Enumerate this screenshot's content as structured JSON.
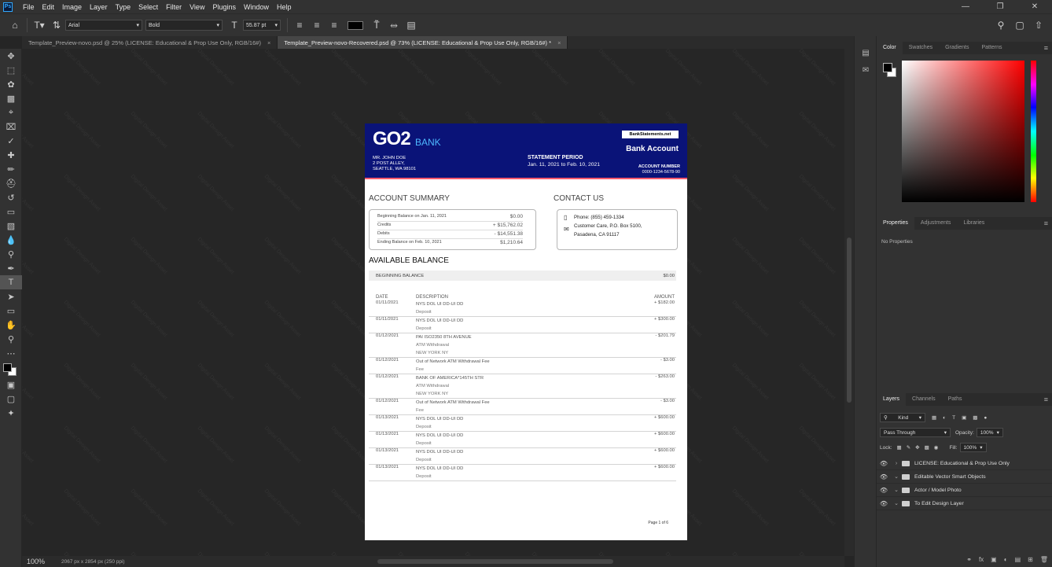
{
  "menubar": {
    "items": [
      "File",
      "Edit",
      "Image",
      "Layer",
      "Type",
      "Select",
      "Filter",
      "View",
      "Plugins",
      "Window",
      "Help"
    ],
    "logo": "Ps"
  },
  "options": {
    "font_family": "Arial",
    "font_style": "Bold",
    "font_size": "55.87 pt"
  },
  "tabs": [
    {
      "label": "Template_Preview-novo.psd @ 25% (LICENSE: Educational & Prop Use Only, RGB/16#)",
      "active": false
    },
    {
      "label": "Template_Preview-novo-Recovered.psd @ 73% (LICENSE: Educational & Prop Use Only, RGB/16#) *",
      "active": true
    }
  ],
  "status": {
    "zoom": "100%",
    "info": "2067 px x 2854 px (250 ppi)"
  },
  "watermark": "Digital Design Asset",
  "doc": {
    "logo_text": "GO2",
    "logo_bank": "BANK",
    "name": "MR. JOHN DOE",
    "addr1": "2 POST ALLEY,",
    "addr2": "SEATTLE, WA 98101",
    "period_label": "STATEMENT PERIOD",
    "period": "Jan. 11, 2021 to Feb. 10, 2021",
    "badge": "BankStatements.net",
    "title": "Bank Account",
    "acct_label": "ACCOUNT NUMBER",
    "acct": "0000-1234-5678-90",
    "summary_title": "ACCOUNT SUMMARY",
    "contact_title": "CONTACT US",
    "summary": [
      {
        "label": "Beginning Balance on Jan. 11, 2021",
        "value": "$0.00"
      },
      {
        "label": "Credits",
        "value": "+ $15,762.02"
      },
      {
        "label": "Debits",
        "value": "- $14,551.38"
      },
      {
        "label": "Ending Balance on Feb. 10, 2021",
        "value": "$1,210.64"
      }
    ],
    "contact": {
      "phone": "Phone: (855) 459-1334",
      "line1": "Customer Care, P.O. Box 5100,",
      "line2": "Pasadena, CA 91117"
    },
    "avail_title": "AVAILABLE BALANCE",
    "beg_label": "BEGINNING BALANCE",
    "beg_value": "$0.00",
    "th": {
      "date": "DATE",
      "desc": "DESCRIPTION",
      "amount": "AMOUNT"
    },
    "transactions": [
      {
        "date": "01/11/2021",
        "desc": "NYS DOL UI DD-UI DD",
        "sub": "Deposit",
        "sub2": "",
        "amount": "+ $182.00"
      },
      {
        "date": "01/11/2021",
        "desc": "NYS DOL UI DD-UI DD",
        "sub": "Deposit",
        "sub2": "",
        "amount": "+ $300.00"
      },
      {
        "date": "01/12/2021",
        "desc": "PAI ISO2350 8TH AVENUE",
        "sub": "ATM Withdrawal",
        "sub2": "NEW YORK NY",
        "amount": "- $201.79"
      },
      {
        "date": "01/12/2021",
        "desc": "Out of Network ATM Withdrawal Fee",
        "sub": "Fee",
        "sub2": "",
        "amount": "- $3.00"
      },
      {
        "date": "01/12/2021",
        "desc": "BANK OF AMERICA*145TH STR",
        "sub": "ATM Withdrawal",
        "sub2": "NEW YORK NY",
        "amount": "- $263.00"
      },
      {
        "date": "01/12/2021",
        "desc": "Out of Network ATM Withdrawal Fee",
        "sub": "Fee",
        "sub2": "",
        "amount": "- $3.00"
      },
      {
        "date": "01/13/2021",
        "desc": "NYS DOL UI DD-UI DD",
        "sub": "Deposit",
        "sub2": "",
        "amount": "+ $600.00"
      },
      {
        "date": "01/13/2021",
        "desc": "NYS DOL UI DD-UI DD",
        "sub": "Deposit",
        "sub2": "",
        "amount": "+ $600.00"
      },
      {
        "date": "01/13/2021",
        "desc": "NYS DOL UI DD-UI DD",
        "sub": "Deposit",
        "sub2": "",
        "amount": "+ $600.00"
      },
      {
        "date": "01/13/2021",
        "desc": "NYS DOL UI DD-UI DD",
        "sub": "Deposit",
        "sub2": "",
        "amount": "+ $600.00"
      }
    ],
    "page": "Page 1 of 6"
  },
  "panels": {
    "color_tabs": [
      "Color",
      "Swatches",
      "Gradients",
      "Patterns"
    ],
    "prop_tabs": [
      "Properties",
      "Adjustments",
      "Libraries"
    ],
    "no_props": "No Properties",
    "layer_tabs": [
      "Layers",
      "Channels",
      "Paths"
    ],
    "kind": "Kind",
    "blend": "Pass Through",
    "opacity_label": "Opacity:",
    "opacity": "100%",
    "lock_label": "Lock:",
    "fill_label": "Fill:",
    "fill": "100%",
    "layers": [
      "LICENSE: Educational & Prop Use Only",
      "Editable Vector Smart Objects",
      "Actor / Model Photo",
      "To Edit Design Layer"
    ]
  }
}
